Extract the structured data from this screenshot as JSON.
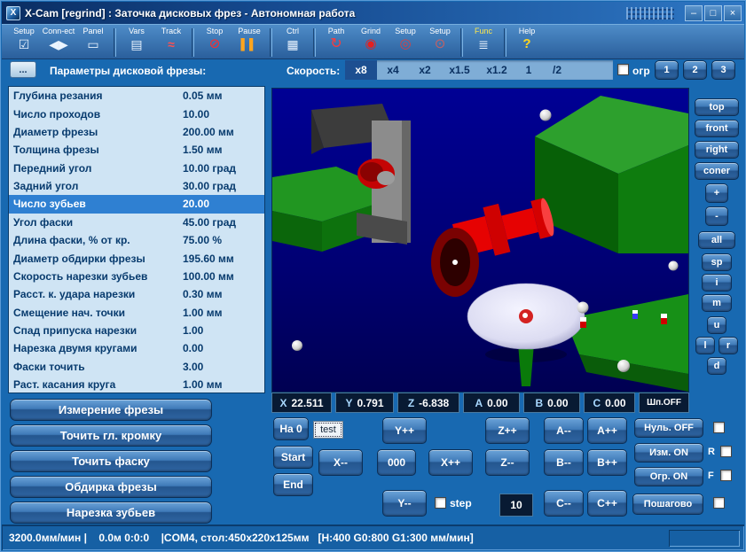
{
  "window": {
    "title": "X-Cam [regrind] : Заточка дисковых фрез  - Автономная работа",
    "icon_text": "X",
    "controls": {
      "minimize": "–",
      "maximize": "□",
      "close": "×"
    }
  },
  "toolbar": {
    "items": [
      {
        "label": "Setup",
        "glyph": "☑"
      },
      {
        "label": "Conn-ect",
        "glyph": "◀▶"
      },
      {
        "label": "Panel",
        "glyph": "▭"
      },
      {
        "label": "Vars",
        "glyph": "▤"
      },
      {
        "label": "Track",
        "glyph": "≈"
      },
      {
        "label": "Stop",
        "glyph": "⊘"
      },
      {
        "label": "Pause",
        "glyph": "▌▌"
      },
      {
        "label": "Ctrl",
        "glyph": "▦"
      },
      {
        "label": "Path",
        "glyph": "↻"
      },
      {
        "label": "Grind",
        "glyph": "◉"
      },
      {
        "label": "Setup",
        "glyph": "◎"
      },
      {
        "label": "Setup",
        "glyph": "⊙"
      },
      {
        "label": "Func",
        "glyph": "≣"
      },
      {
        "label": "Help",
        "glyph": "?"
      }
    ]
  },
  "header": {
    "more": "...",
    "params_title": "Параметры дисковой фрезы:",
    "speed_label": "Скорость:",
    "speed_options": [
      "x8",
      "x4",
      "x2",
      "x1.5",
      "x1.2",
      "1",
      "/2"
    ],
    "speed_selected": "x8",
    "limit_label": "огр",
    "presets": [
      "1",
      "2",
      "3"
    ]
  },
  "parameters": [
    {
      "name": "Глубина резания",
      "value": "0.05 мм"
    },
    {
      "name": "Число проходов",
      "value": "10.00"
    },
    {
      "name": "Диаметр фрезы",
      "value": "200.00 мм"
    },
    {
      "name": "Толщина фрезы",
      "value": "1.50 мм"
    },
    {
      "name": "Передний угол",
      "value": "10.00 град"
    },
    {
      "name": "Задний угол",
      "value": "30.00 град"
    },
    {
      "name": "Число зубьев",
      "value": "20.00"
    },
    {
      "name": "Угол фаски",
      "value": "45.00 град"
    },
    {
      "name": "Длина фаски, % от кр.",
      "value": "75.00 %"
    },
    {
      "name": "Диаметр обдирки фрезы",
      "value": "195.60 мм"
    },
    {
      "name": "Скорость нарезки зубьев",
      "value": "100.00 мм"
    },
    {
      "name": "Расст. к. удара нарезки",
      "value": "0.30 мм"
    },
    {
      "name": "Смещение нач. точки",
      "value": "1.00 мм"
    },
    {
      "name": "Спад припуска нарезки",
      "value": "1.00"
    },
    {
      "name": "Нарезка двумя кругами",
      "value": "0.00"
    },
    {
      "name": "Фаски точить",
      "value": "3.00"
    },
    {
      "name": "Раст. касания круга",
      "value": "1.00 мм"
    }
  ],
  "view_buttons": {
    "top": "top",
    "front": "front",
    "right": "right",
    "coner": "coner",
    "zoom_in": "+",
    "zoom_out": "-",
    "all": "all",
    "sp": "sp",
    "i": "i",
    "m": "m",
    "u": "u",
    "l": "l",
    "r": "r",
    "d": "d"
  },
  "actions": [
    "Измерение фрезы",
    "Точить гл. кромку",
    "Точить фаску",
    "Обдирка фрезы",
    "Нарезка зубьев"
  ],
  "coords": {
    "x": {
      "axis": "X",
      "value": "22.511"
    },
    "y": {
      "axis": "Y",
      "value": "0.791"
    },
    "z": {
      "axis": "Z",
      "value": "-6.838"
    },
    "a": {
      "axis": "A",
      "value": "0.00"
    },
    "b": {
      "axis": "B",
      "value": "0.00"
    },
    "c": {
      "axis": "C",
      "value": "0.00"
    },
    "spindle": "Шп.OFF"
  },
  "jog": {
    "na0": "На 0",
    "test": "test",
    "start": "Start",
    "end": "End",
    "y_plus": "Y++",
    "y_minus": "Y--",
    "x_minus": "X--",
    "zero": "000",
    "x_plus": "X++",
    "z_plus": "Z++",
    "z_minus": "Z--",
    "a_minus": "A--",
    "a_plus": "A++",
    "b_minus": "B--",
    "b_plus": "B++",
    "c_minus": "C--",
    "c_plus": "C++",
    "null_off": "Нуль. OFF",
    "izm_on": "Изм. ON",
    "ogr_on": "Огр. ON",
    "poshagovo": "Пошагово",
    "step_label": "step",
    "step_value": "10",
    "r_label": "R",
    "f_label": "F"
  },
  "status": {
    "text": "3200.0мм/мин |    0.0м 0:0:0    |COM4, стол:450x220x125мм   [H:400 G0:800 G1:300 мм/мин]"
  },
  "colors": {
    "selection": "#2f80d2",
    "panel_bg": "#cfe4f4",
    "window_bg": "#1869b1",
    "view_bg": "#000078"
  }
}
